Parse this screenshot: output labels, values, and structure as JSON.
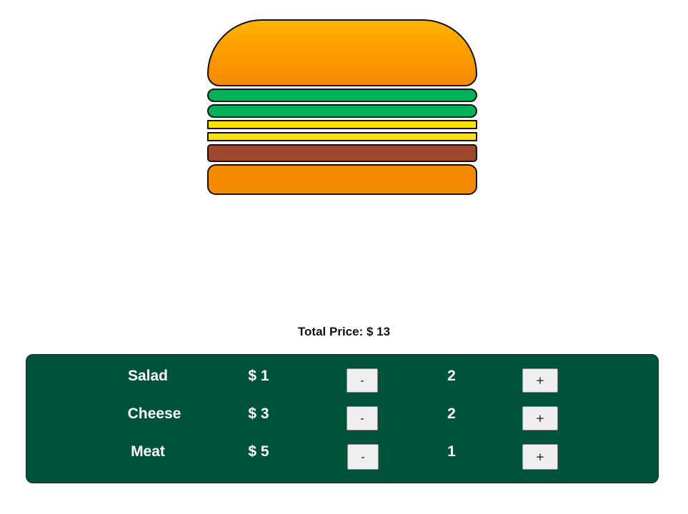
{
  "colors": {
    "bun": "#f48a00",
    "salad": "#00b15a",
    "cheese": "#ffe000",
    "meat": "#a0472f",
    "panel": "#00523a"
  },
  "burger": {
    "layers": [
      "bun-top",
      "salad",
      "salad",
      "cheese",
      "cheese",
      "meat",
      "bun-bottom"
    ]
  },
  "total": {
    "label": "Total Price: $ 13"
  },
  "ingredients": [
    {
      "name": "Salad",
      "price": "$ 1",
      "minus_label": "-",
      "count": "2",
      "plus_label": "+"
    },
    {
      "name": "Cheese",
      "price": "$ 3",
      "minus_label": "-",
      "count": "2",
      "plus_label": "+"
    },
    {
      "name": "Meat",
      "price": "$ 5",
      "minus_label": "-",
      "count": "1",
      "plus_label": "+"
    }
  ]
}
